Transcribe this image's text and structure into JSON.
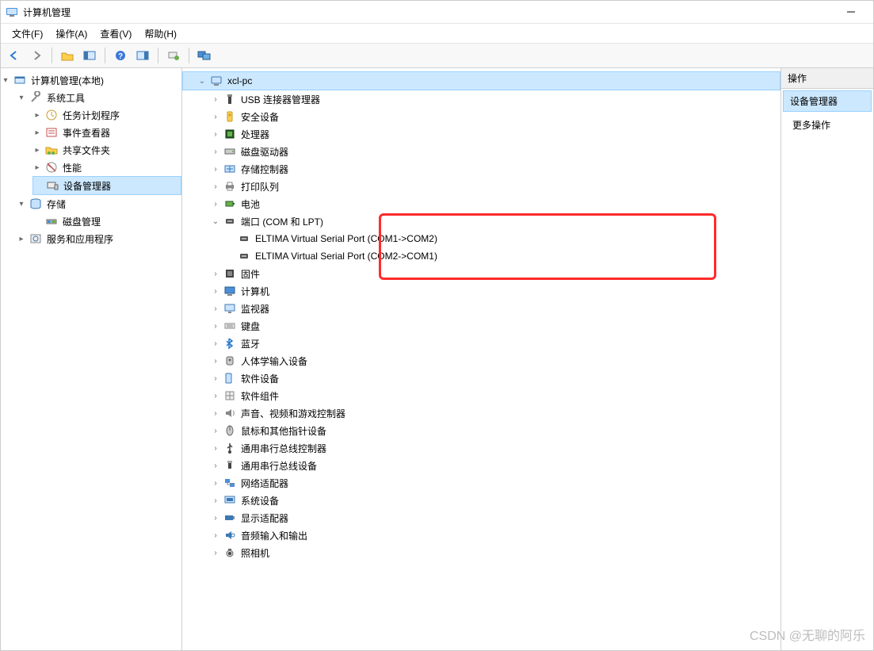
{
  "window": {
    "title": "计算机管理"
  },
  "menubar": {
    "items": [
      {
        "label": "文件(F)"
      },
      {
        "label": "操作(A)"
      },
      {
        "label": "查看(V)"
      },
      {
        "label": "帮助(H)"
      }
    ]
  },
  "toolbar": {
    "buttons": [
      {
        "name": "back-icon"
      },
      {
        "name": "forward-icon"
      },
      {
        "name": "sep"
      },
      {
        "name": "folder-up-icon"
      },
      {
        "name": "show-hide-tree-icon"
      },
      {
        "name": "sep"
      },
      {
        "name": "help-icon"
      },
      {
        "name": "pane-icon"
      },
      {
        "name": "sep"
      },
      {
        "name": "scan-hardware-icon"
      },
      {
        "name": "sep"
      },
      {
        "name": "monitors-icon"
      }
    ]
  },
  "leftTree": {
    "root": {
      "label": "计算机管理(本地)"
    },
    "sys": {
      "label": "系统工具",
      "children": [
        {
          "label": "任务计划程序",
          "icon": "clock-icon"
        },
        {
          "label": "事件查看器",
          "icon": "event-icon"
        },
        {
          "label": "共享文件夹",
          "icon": "shared-folder-icon"
        },
        {
          "label": "性能",
          "icon": "performance-icon"
        },
        {
          "label": "设备管理器",
          "icon": "device-manager-icon",
          "selected": true
        }
      ]
    },
    "storage": {
      "label": "存储",
      "children": [
        {
          "label": "磁盘管理",
          "icon": "disk-mgmt-icon"
        }
      ]
    },
    "services": {
      "label": "服务和应用程序",
      "icon": "services-icon"
    }
  },
  "deviceTree": {
    "root": {
      "label": "xcl-pc"
    },
    "categories": [
      {
        "label": "USB 连接器管理器",
        "icon": "usb-connector-icon"
      },
      {
        "label": "安全设备",
        "icon": "security-device-icon"
      },
      {
        "label": "处理器",
        "icon": "cpu-icon"
      },
      {
        "label": "磁盘驱动器",
        "icon": "disk-drive-icon"
      },
      {
        "label": "存储控制器",
        "icon": "storage-controller-icon"
      },
      {
        "label": "打印队列",
        "icon": "printer-icon"
      },
      {
        "label": "电池",
        "icon": "battery-icon"
      },
      {
        "label": "端口 (COM 和 LPT)",
        "icon": "port-icon",
        "expanded": true,
        "children": [
          {
            "label": "ELTIMA Virtual Serial Port (COM1->COM2)",
            "icon": "port-icon"
          },
          {
            "label": "ELTIMA Virtual Serial Port (COM2->COM1)",
            "icon": "port-icon"
          }
        ]
      },
      {
        "label": "固件",
        "icon": "firmware-icon"
      },
      {
        "label": "计算机",
        "icon": "computer-icon"
      },
      {
        "label": "监视器",
        "icon": "monitor-icon"
      },
      {
        "label": "键盘",
        "icon": "keyboard-icon"
      },
      {
        "label": "蓝牙",
        "icon": "bluetooth-icon"
      },
      {
        "label": "人体学输入设备",
        "icon": "hid-icon"
      },
      {
        "label": "软件设备",
        "icon": "software-device-icon"
      },
      {
        "label": "软件组件",
        "icon": "software-component-icon"
      },
      {
        "label": "声音、视频和游戏控制器",
        "icon": "sound-icon"
      },
      {
        "label": "鼠标和其他指针设备",
        "icon": "mouse-icon"
      },
      {
        "label": "通用串行总线控制器",
        "icon": "usb-controller-icon"
      },
      {
        "label": "通用串行总线设备",
        "icon": "usb-device-icon"
      },
      {
        "label": "网络适配器",
        "icon": "network-icon"
      },
      {
        "label": "系统设备",
        "icon": "system-device-icon"
      },
      {
        "label": "显示适配器",
        "icon": "display-adapter-icon"
      },
      {
        "label": "音频输入和输出",
        "icon": "audio-io-icon"
      },
      {
        "label": "照相机",
        "icon": "camera-icon"
      }
    ]
  },
  "actionsPane": {
    "header": "操作",
    "selected": "设备管理器",
    "more": "更多操作"
  },
  "watermark": "CSDN @无聊的阿乐"
}
